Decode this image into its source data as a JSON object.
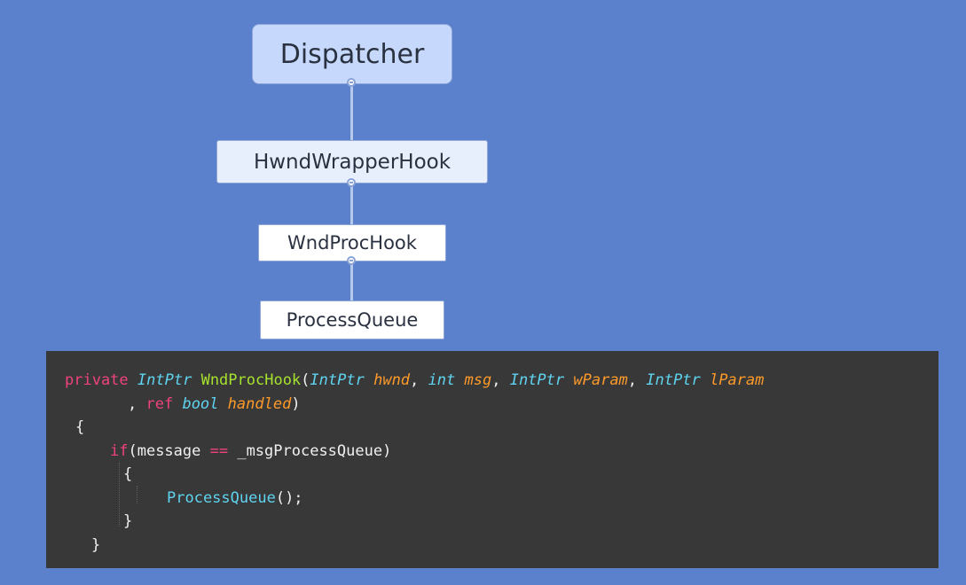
{
  "tree": {
    "root": "Dispatcher",
    "level1": "HwndWrapperHook",
    "level2": "WndProcHook",
    "level3": "ProcessQueue"
  },
  "code": {
    "line1": {
      "kw_private": "private",
      "type_ret": "IntPtr",
      "func_name": "WndProcHook",
      "paren_open": "(",
      "type_hwnd": "IntPtr",
      "param_hwnd": "hwnd",
      "comma1": ", ",
      "type_msg": "int",
      "param_msg": "msg",
      "comma2": ", ",
      "type_wparam": "IntPtr",
      "param_wparam": "wParam",
      "comma3": ", ",
      "type_lparam": "IntPtr",
      "param_lparam": "lParam"
    },
    "line2": {
      "comma": ", ",
      "kw_ref": "ref",
      "type_bool": "bool",
      "param_handled": "handled",
      "paren_close": ")"
    },
    "line3": {
      "brace": "{"
    },
    "line4": {
      "kw_if": "if",
      "paren_open": "(message ",
      "op_eq": "==",
      "rest": " _msgProcessQueue)"
    },
    "line5": {
      "brace": "{"
    },
    "line6": {
      "call": "ProcessQueue",
      "rest": "();"
    },
    "line7": {
      "brace": "}"
    },
    "line8": {
      "brace": "}"
    }
  }
}
